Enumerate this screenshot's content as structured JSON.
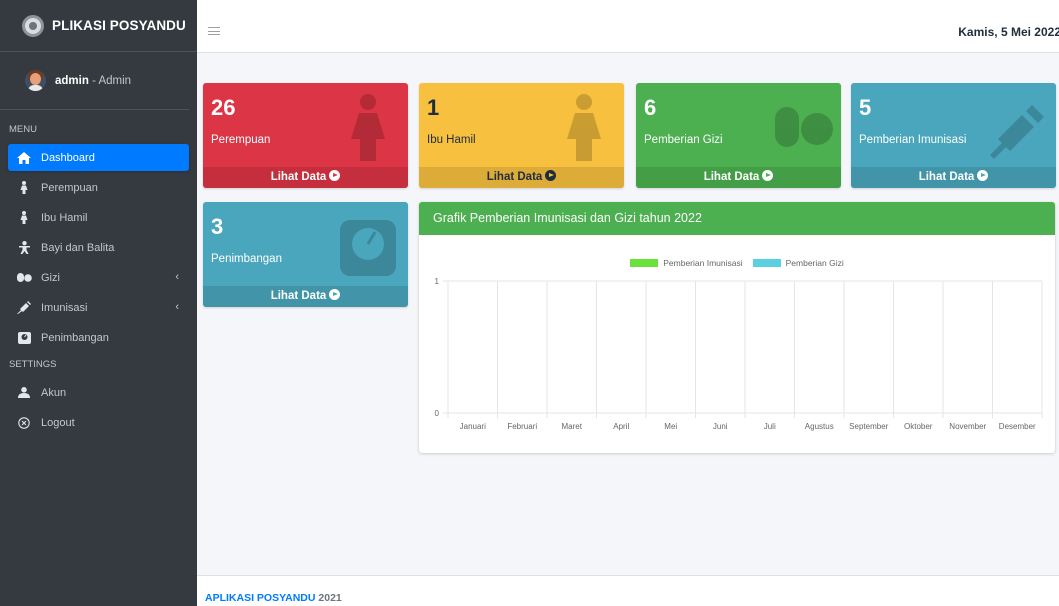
{
  "app": {
    "brand": "PLIKASI POSYANDU",
    "user_name": "admin",
    "user_role": " - Admin"
  },
  "header": {
    "date": "Kamis, 5 Mei 2022"
  },
  "sidebar": {
    "menu_header": "MENU",
    "settings_header": "SETTINGS",
    "items": [
      {
        "label": "Dashboard",
        "icon": "home-icon"
      },
      {
        "label": "Perempuan",
        "icon": "female-icon"
      },
      {
        "label": "Ibu Hamil",
        "icon": "female-icon"
      },
      {
        "label": "Bayi dan Balita",
        "icon": "baby-icon"
      },
      {
        "label": "Gizi",
        "icon": "pills-icon"
      },
      {
        "label": "Imunisasi",
        "icon": "syringe-icon"
      },
      {
        "label": "Penimbangan",
        "icon": "weight-icon"
      }
    ],
    "settings_items": [
      {
        "label": "Akun",
        "icon": "user-icon"
      },
      {
        "label": "Logout",
        "icon": "close-circle-icon"
      }
    ]
  },
  "stats": [
    {
      "value": "26",
      "label": "Perempuan",
      "link": "Lihat Data",
      "color": "#dc3545"
    },
    {
      "value": "1",
      "label": "Ibu Hamil",
      "link": "Lihat Data",
      "color": "#f7c03f"
    },
    {
      "value": "6",
      "label": "Pemberian Gizi",
      "link": "Lihat Data",
      "color": "#4caf50"
    },
    {
      "value": "5",
      "label": "Pemberian Imunisasi",
      "link": "Lihat Data",
      "color": "#4aa6bd"
    },
    {
      "value": "3",
      "label": "Penimbangan",
      "link": "Lihat Data",
      "color": "#4aa6bd"
    }
  ],
  "chart_card": {
    "title": "Grafik Pemberian Imunisasi dan Gizi tahun 2022"
  },
  "chart_data": {
    "type": "bar",
    "categories": [
      "Januari",
      "Februari",
      "Maret",
      "April",
      "Mei",
      "Juni",
      "Juli",
      "Agustus",
      "September",
      "Oktober",
      "November",
      "Desember"
    ],
    "series": [
      {
        "name": "Pemberian Imunisasi",
        "color": "#6be13b",
        "values": [
          0,
          0,
          0,
          0,
          0,
          0,
          0,
          0,
          0,
          0,
          0,
          0
        ]
      },
      {
        "name": "Pemberian Gizi",
        "color": "#5bd0e0",
        "values": [
          0,
          0,
          0,
          0,
          0,
          0,
          0,
          0,
          0,
          0,
          0,
          0
        ]
      }
    ],
    "ylim": [
      0,
      1
    ],
    "yticks": [
      "1",
      "0"
    ],
    "grid": true,
    "legend": "top-center"
  },
  "footer": {
    "brand": "APLIKASI POSYANDU",
    "year": " 2021"
  }
}
